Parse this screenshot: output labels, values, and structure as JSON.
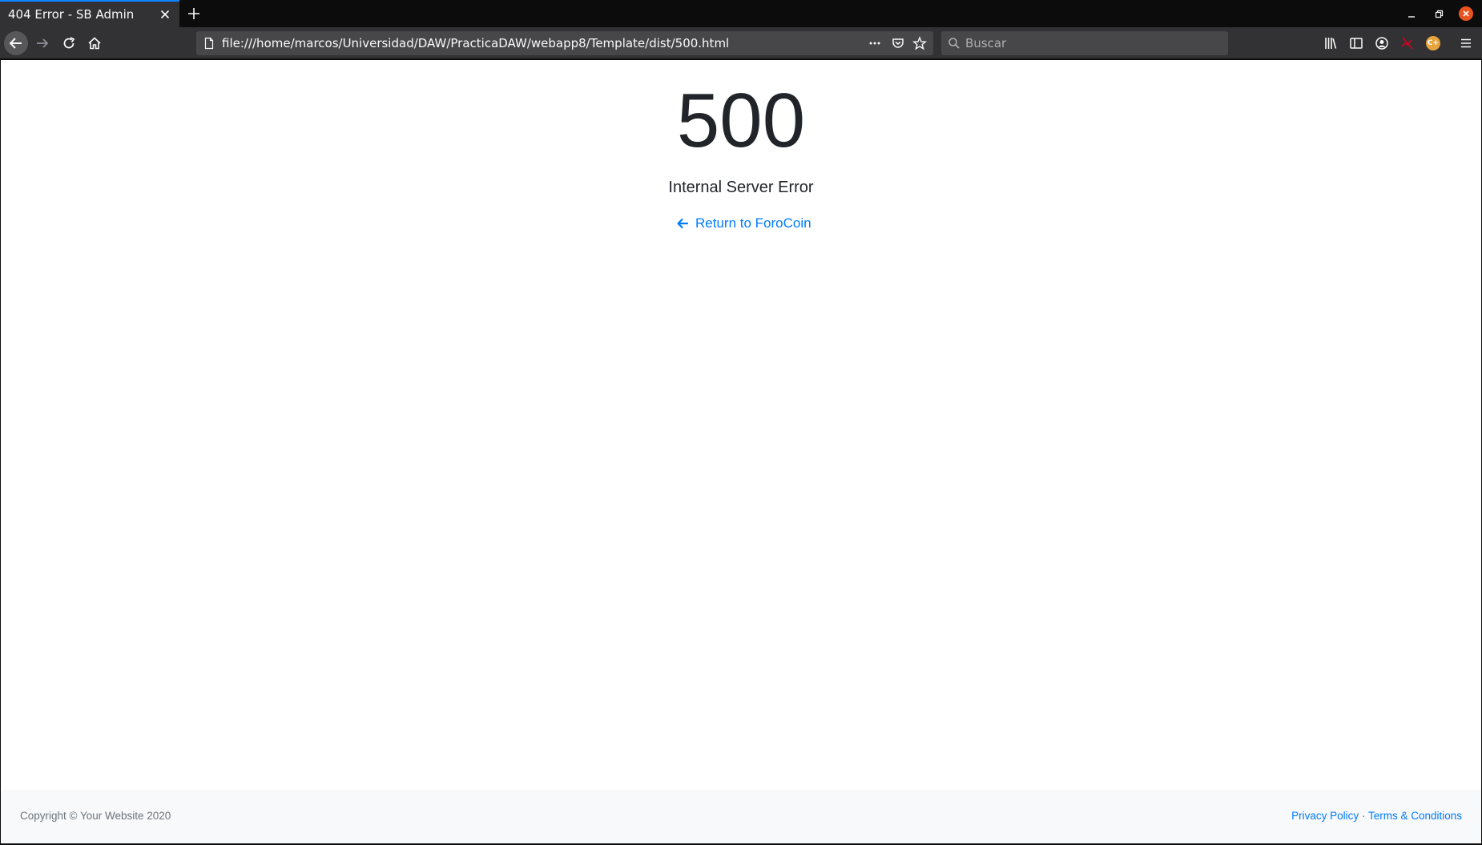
{
  "browser": {
    "tab_title": "404 Error - SB Admin",
    "url": "file:///home/marcos/Universidad/DAW/PracticaDAW/webapp8/Template/dist/500.html",
    "search_placeholder": "Buscar",
    "extension_badge": "C+"
  },
  "page": {
    "error_code": "500",
    "error_message": "Internal Server Error",
    "return_link": "Return to ForoCoin"
  },
  "footer": {
    "copyright": "Copyright © Your Website 2020",
    "privacy": "Privacy Policy",
    "separator": "·",
    "terms": "Terms & Conditions"
  },
  "colors": {
    "accent": "#007bff",
    "tab_highlight": "#0a84ff",
    "close_button": "#e95420"
  }
}
